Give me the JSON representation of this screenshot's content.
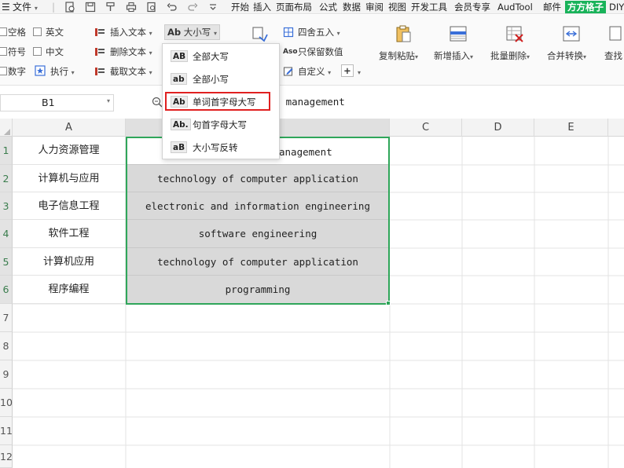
{
  "menubar": {
    "file_label": "文件",
    "tabs": [
      "开始",
      "插入",
      "页面布局",
      "公式",
      "数据",
      "审阅",
      "视图",
      "开发工具",
      "会员专享",
      "AudTool",
      "邮件",
      "方方格子",
      "DIY"
    ],
    "brand_color": "#19b35a"
  },
  "ribbon": {
    "checks": [
      {
        "label": "空格"
      },
      {
        "label": "英文"
      },
      {
        "label": "符号"
      },
      {
        "label": "中文"
      },
      {
        "label": "数字"
      }
    ],
    "execute_label": "执行",
    "insert_text": "插入文本",
    "delete_text": "删除文本",
    "extract_text": "截取文本",
    "case_label": "大小写",
    "case_icon_text": "Ab",
    "round_label": "四舍五入",
    "keep_value_label": "只保留数值",
    "keep_value_icon": "Aso",
    "custom_label": "自定义",
    "big_buttons": [
      {
        "label": "复制粘贴"
      },
      {
        "label": "新增插入"
      },
      {
        "label": "批量删除"
      },
      {
        "label": "合并转换"
      },
      {
        "label": "查找"
      }
    ]
  },
  "formula_bar": {
    "cell_ref": "B1",
    "content": "ce management"
  },
  "grid": {
    "columns": [
      "A",
      "",
      "C",
      "D",
      "E"
    ],
    "row_numbers": [
      "1",
      "2",
      "3",
      "4",
      "5",
      "6",
      "7",
      "8",
      "9",
      "10",
      "11",
      "12"
    ],
    "rows": [
      {
        "a": "人力资源管理",
        "b": "anagement"
      },
      {
        "a": "计算机与应用",
        "b": "technology of computer application"
      },
      {
        "a": "电子信息工程",
        "b": "electronic and information engineering"
      },
      {
        "a": "软件工程",
        "b": "software engineering"
      },
      {
        "a": "计算机应用",
        "b": "technology of computer application"
      },
      {
        "a": "程序编程",
        "b": "programming"
      }
    ],
    "selection_color": "#2fa65a"
  },
  "dropdown": {
    "items": [
      {
        "icon": "AB",
        "label": "全部大写"
      },
      {
        "icon": "ab",
        "label": "全部小写"
      },
      {
        "icon": "Ab",
        "label": "单词首字母大写"
      },
      {
        "icon": "Ab.",
        "label": "句首字母大写"
      },
      {
        "icon": "aB",
        "label": "大小写反转"
      }
    ],
    "highlight_color": "#e02020"
  }
}
